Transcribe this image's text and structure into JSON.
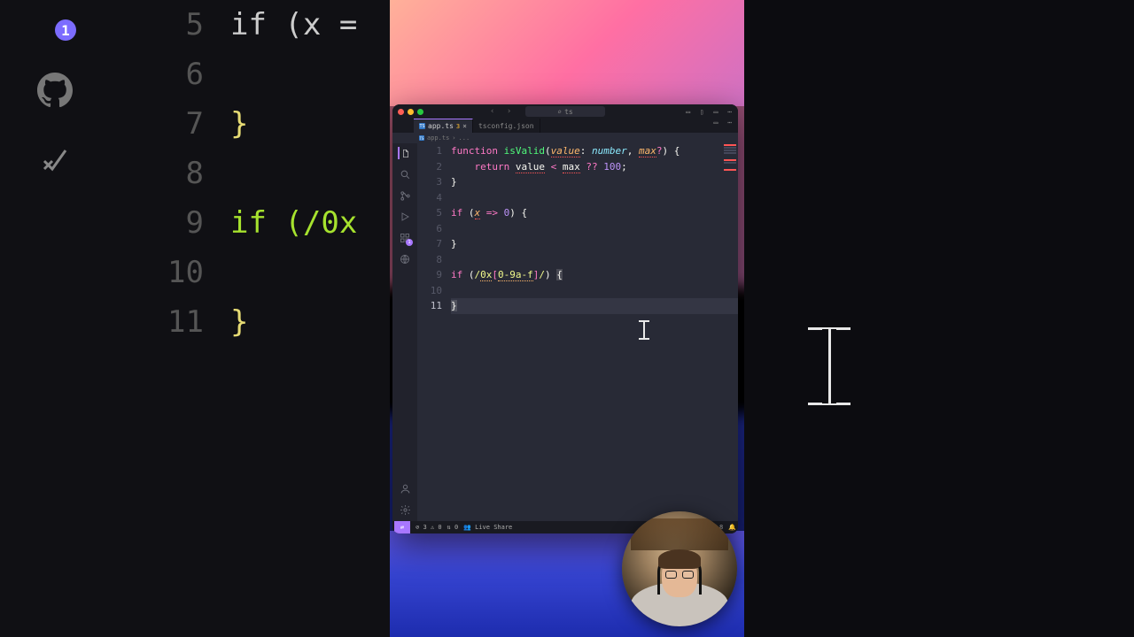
{
  "titlebar": {
    "search_placeholder": "ts"
  },
  "activity_badge_count": "1",
  "ext_badge_count": "1",
  "tabs": [
    {
      "name": "app.ts",
      "active": true,
      "dirty_badge": "3"
    },
    {
      "name": "tsconfig.json",
      "active": false
    }
  ],
  "breadcrumb": {
    "file_icon": "TS",
    "file": "app.ts",
    "sep": "›",
    "rest": "..."
  },
  "gutter": [
    "1",
    "2",
    "3",
    "4",
    "5",
    "6",
    "7",
    "8",
    "9",
    "10",
    "11"
  ],
  "big_gutter": [
    "5",
    "6",
    "7",
    "8",
    "9",
    "10",
    "11"
  ],
  "code": {
    "l1": {
      "a": "function ",
      "b": "isValid",
      "c": "(",
      "d": "value",
      "e": ": ",
      "f": "number",
      "g": ", ",
      "h": "max",
      "i": "?",
      "j": ") {"
    },
    "l2": {
      "a": "    ",
      "b": "return ",
      "c": "value",
      "d": " < ",
      "e": "max",
      "f": " ?? ",
      "g": "100",
      "h": ";"
    },
    "l3": "}",
    "l5": {
      "a": "if ",
      "b": "(",
      "c": "x",
      "d": " => ",
      "e": "0",
      "f": ") {"
    },
    "l7": "}",
    "l9": {
      "a": "if ",
      "b": "(",
      "c": "/",
      "d": "0x",
      "e": "[",
      "f": "0-9a-f",
      "g": "]",
      "h": "/",
      "i": ") ",
      "j": "{"
    },
    "l11": "}"
  },
  "big_code": {
    "l5_prefix": "if (x  =",
    "l7": "}",
    "l9_prefix": "if (/0x",
    "l11": "}"
  },
  "status": {
    "errors": "3",
    "warnings": "0",
    "ports": "0",
    "liveshare": "Live Share",
    "encoding": "UTF-8"
  },
  "colors": {
    "accent": "#a877ff",
    "bg": "#282a36",
    "error": "#ff5555"
  }
}
